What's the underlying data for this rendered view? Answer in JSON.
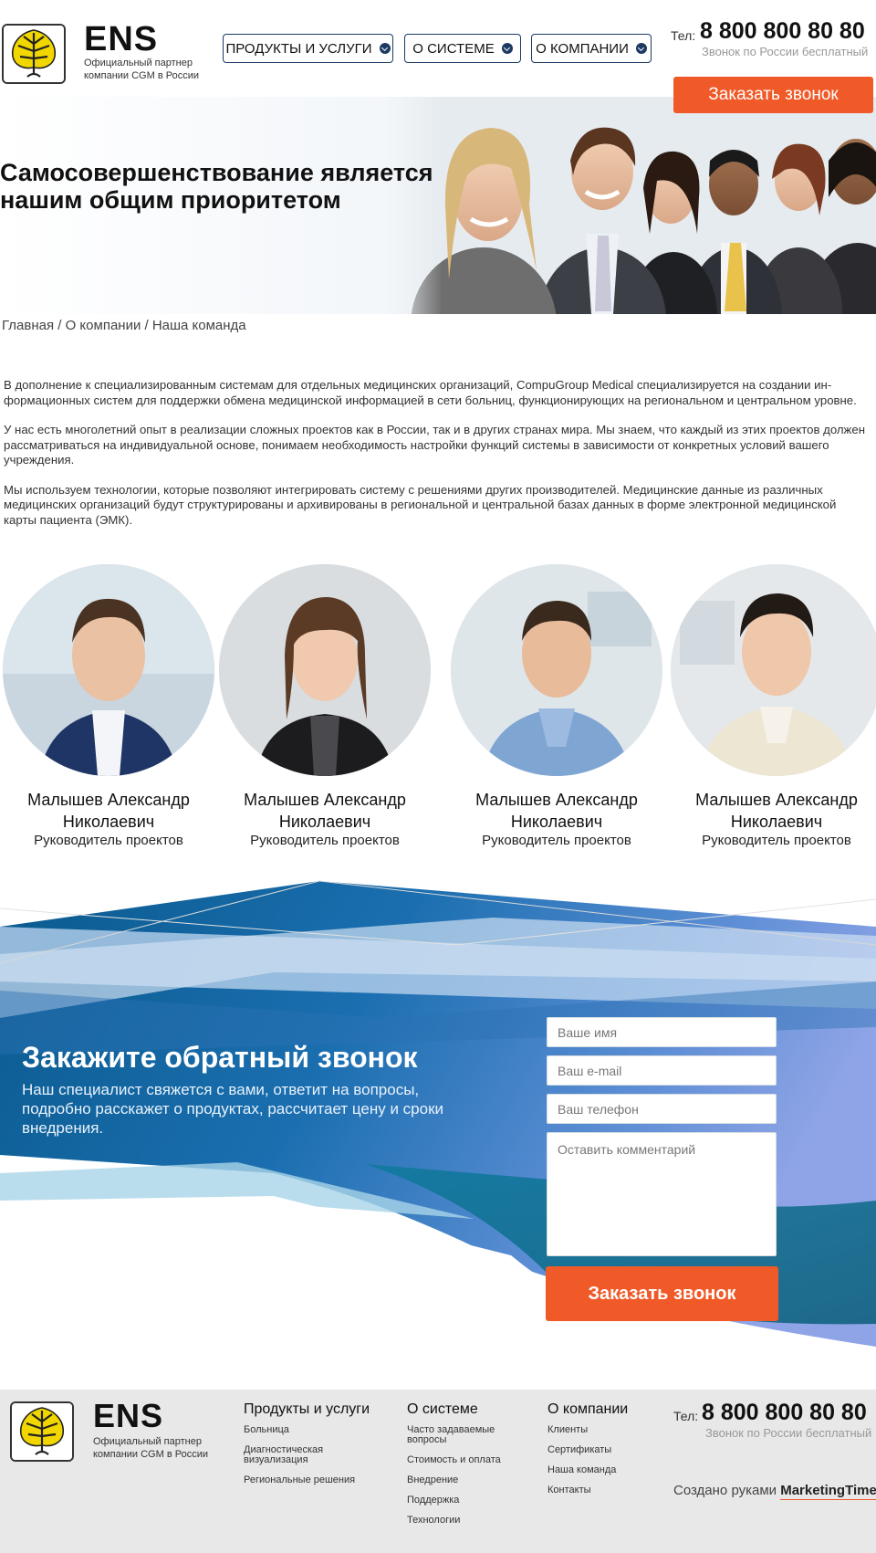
{
  "brand": {
    "name": "ENS",
    "subtitle": "Официальный партнер компании CGM в России"
  },
  "nav": [
    {
      "label": "ПРОДУКТЫ И УСЛУГИ"
    },
    {
      "label": "О СИСТЕМЕ"
    },
    {
      "label": "О КОМПАНИИ"
    }
  ],
  "contact": {
    "tel_label": "Тел:",
    "phone": "8 800 800 80 80",
    "phone_note": "Звонок по России бесплатный",
    "order_call": "Заказать звонок"
  },
  "hero": {
    "title_line1": "Самосовершенствование является",
    "title_line2": "нашим общим приоритетом"
  },
  "breadcrumb": "Главная / О компании / Наша команда",
  "intro": [
    "В дополнение к специализированным системам для отдельных медицинских организаций, CompuGroup Medical специализируется на создании ин-формационных систем для поддержки обмена медицинской информацией в сети больниц, функционирующих на региональном и центральном уровне.",
    "У нас есть многолетний опыт в реализации сложных проектов как в России, так и в других странах мира. Мы знаем, что каждый из этих проектов должен рассматриваться на индивидуальной основе, понимаем необходимость настройки функций системы в зависимости от конкретных условий вашего учреждения.",
    "Мы используем технологии, которые позволяют интегрировать систему с решениями других производителей. Медицинские данные из различных медицинских организаций будут структурированы и архивированы в региональной и центральной базах данных в форме электронной медицинской карты пациента (ЭМК)."
  ],
  "team": [
    {
      "name_line1": "Малышев Александр",
      "name_line2": "Николаевич",
      "role": "Руководитель проектов"
    },
    {
      "name_line1": "Малышев Александр",
      "name_line2": "Николаевич",
      "role": "Руководитель проектов"
    },
    {
      "name_line1": "Малышев Александр",
      "name_line2": "Николаевич",
      "role": "Руководитель проектов"
    },
    {
      "name_line1": "Малышев Александр",
      "name_line2": "Николаевич",
      "role": "Руководитель проектов"
    }
  ],
  "callback": {
    "title": "Закажите обратный звонок",
    "text": "Наш специалист свяжется с вами, ответит на вопросы, подробно расскажет о продуктах, рассчитает цену и сроки внедрения.",
    "name_placeholder": "Ваше имя",
    "email_placeholder": "Ваш e-mail",
    "phone_placeholder": "Ваш телефон",
    "comment_placeholder": "Оставить комментарий",
    "submit": "Заказать звонок"
  },
  "footer": {
    "columns": [
      {
        "title": "Продукты и услуги",
        "links": [
          "Больница",
          "Диагностическая визуализация",
          "Региональные решения"
        ]
      },
      {
        "title": "О системе",
        "links": [
          "Часто задаваемые вопросы",
          "Стоимость и оплата",
          "Внедрение",
          "Поддержка",
          "Технологии"
        ]
      },
      {
        "title": "О компании",
        "links": [
          "Клиенты",
          "Сертификаты",
          "Наша команда",
          "Контакты"
        ]
      }
    ],
    "made_by_prefix": "Создано руками",
    "made_by_brand": "MarketingTime"
  },
  "colors": {
    "accent": "#f05a28",
    "nav_border": "#1c3a64",
    "footer_bg": "#e8e8e8"
  }
}
